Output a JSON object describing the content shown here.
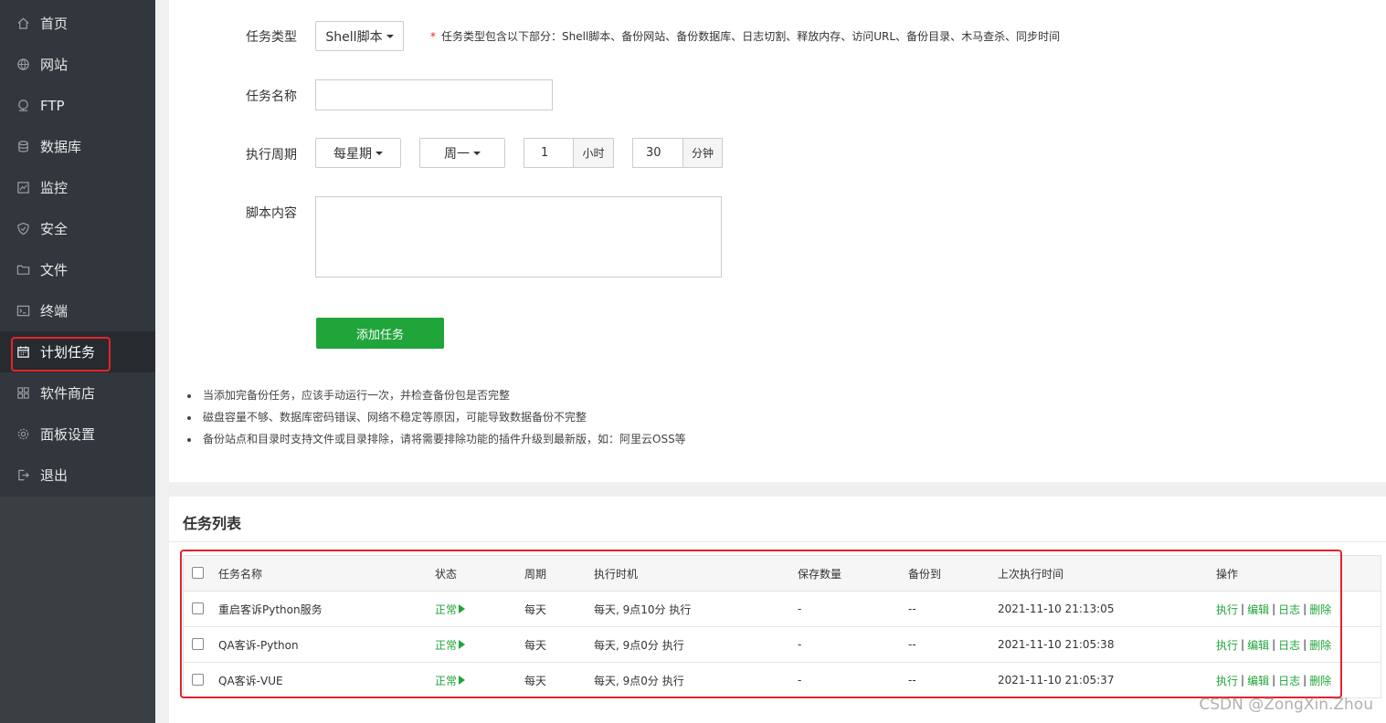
{
  "sidebar": {
    "items": [
      {
        "label": "首页",
        "icon": "home-icon"
      },
      {
        "label": "网站",
        "icon": "globe-icon"
      },
      {
        "label": "FTP",
        "icon": "ftp-icon"
      },
      {
        "label": "数据库",
        "icon": "database-icon"
      },
      {
        "label": "监控",
        "icon": "monitor-icon"
      },
      {
        "label": "安全",
        "icon": "shield-icon"
      },
      {
        "label": "文件",
        "icon": "folder-icon"
      },
      {
        "label": "终端",
        "icon": "terminal-icon"
      },
      {
        "label": "计划任务",
        "icon": "calendar-icon",
        "active": true
      },
      {
        "label": "软件商店",
        "icon": "apps-icon"
      },
      {
        "label": "面板设置",
        "icon": "gear-icon"
      },
      {
        "label": "退出",
        "icon": "logout-icon"
      }
    ]
  },
  "form": {
    "task_type_label": "任务类型",
    "task_type_value": "Shell脚本",
    "task_type_hint": "任务类型包含以下部分：Shell脚本、备份网站、备份数据库、日志切割、释放内存、访问URL、备份目录、木马查杀、同步时间",
    "task_name_label": "任务名称",
    "task_name_value": "",
    "period_label": "执行周期",
    "period_type": "每星期",
    "period_day": "周一",
    "hour_value": "1",
    "hour_unit": "小时",
    "minute_value": "30",
    "minute_unit": "分钟",
    "script_label": "脚本内容",
    "script_value": "",
    "add_button": "添加任务",
    "tips": [
      "当添加完备份任务，应该手动运行一次，并检查备份包是否完整",
      "磁盘容量不够、数据库密码错误、网络不稳定等原因，可能导致数据备份不完整",
      "备份站点和目录时支持文件或目录排除，请将需要排除功能的插件升级到最新版，如：阿里云OSS等"
    ]
  },
  "task_list": {
    "title": "任务列表",
    "columns": [
      "任务名称",
      "状态",
      "周期",
      "执行时机",
      "保存数量",
      "备份到",
      "上次执行时间",
      "操作"
    ],
    "rows": [
      {
        "name": "重启客诉Python服务",
        "status": "正常",
        "period": "每天",
        "timing": "每天, 9点10分 执行",
        "keep": "-",
        "backup_to": "--",
        "last_run": "2021-11-10 21:13:05"
      },
      {
        "name": "QA客诉-Python",
        "status": "正常",
        "period": "每天",
        "timing": "每天, 9点0分 执行",
        "keep": "-",
        "backup_to": "--",
        "last_run": "2021-11-10 21:05:38"
      },
      {
        "name": "QA客诉-VUE",
        "status": "正常",
        "period": "每天",
        "timing": "每天, 9点0分 执行",
        "keep": "-",
        "backup_to": "--",
        "last_run": "2021-11-10 21:05:37"
      }
    ],
    "actions": [
      "执行",
      "编辑",
      "日志",
      "删除"
    ],
    "action_separator": "|"
  },
  "watermark": "CSDN @ZongXin.Zhou",
  "colors": {
    "accent": "#20a53a",
    "sidebar_bg": "#31373c",
    "highlight": "#e3242b"
  }
}
